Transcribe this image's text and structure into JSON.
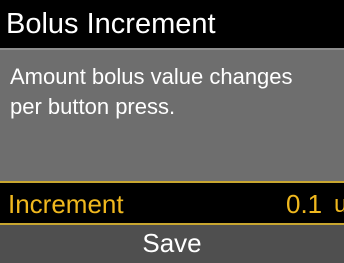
{
  "header": {
    "title": "Bolus Increment"
  },
  "description": {
    "lines": [
      "Amount bolus value changes",
      "per button press."
    ]
  },
  "setting": {
    "label": "Increment",
    "value": "0.1",
    "unit": "u"
  },
  "footer": {
    "save_label": "Save"
  },
  "colors": {
    "highlight": "#f0b81e",
    "divider": "#c8a630",
    "panel": "#6e6e6e",
    "save_bar": "#4f4f4f",
    "background": "#000000"
  }
}
